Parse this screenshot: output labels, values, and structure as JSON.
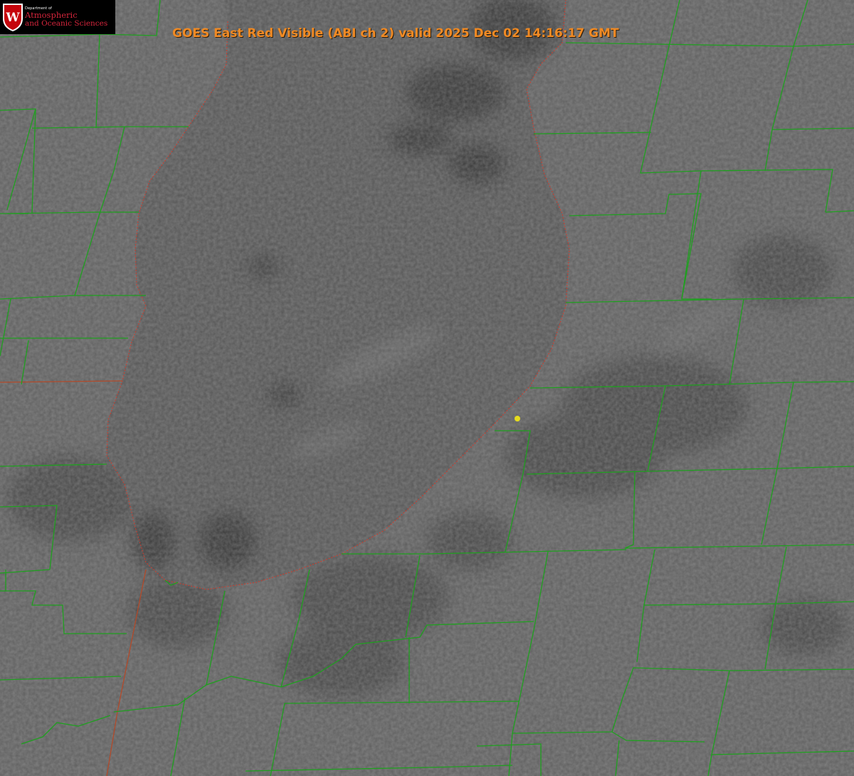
{
  "title": "GOES East Red Visible (ABI ch 2) valid 2025 Dec 02 14:16:17 GMT",
  "logo": {
    "department": "Department of",
    "line1": "Atmospheric",
    "line2": "and Oceanic Sciences",
    "seal_letter": "W"
  },
  "colors": {
    "county_lines": "#1fa01f",
    "lake_shoreline": "#d23b2b",
    "title_text": "#f08a24",
    "marker": "#e6dc1e",
    "logo_text": "#d6253c"
  },
  "map": {
    "imagery": "grayscale visible satellite",
    "feature": "Lake Michigan (southern basin)",
    "marker_icon": "yellow-dot-icon"
  }
}
